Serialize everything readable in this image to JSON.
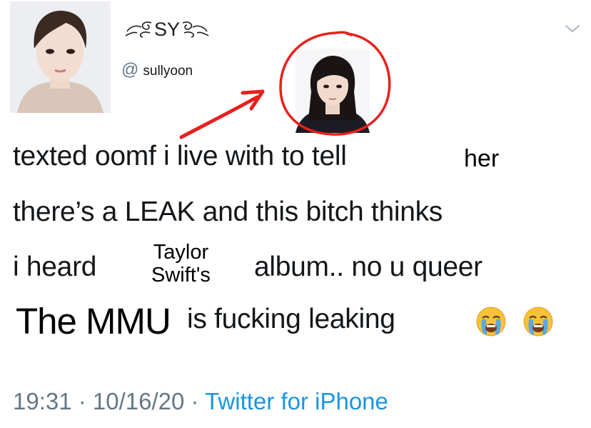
{
  "tweet": {
    "display_name": "⸙SY⸙",
    "display_name_text": "SY",
    "handle": "sullyoon",
    "handle_prefix": "@",
    "body": {
      "line_1": "texted oomf i live with to tell",
      "line_2": "there’s a LEAK and this bitch thinks",
      "line_3_before": "i heard",
      "line_3_after": "album.. no u queer",
      "line_4_after": "is fucking leaking"
    },
    "emojis": [
      "loudly-crying-face",
      "loudly-crying-face"
    ],
    "timestamp": "19:31 · 10/16/20 · ",
    "source": "Twitter for iPhone"
  },
  "overlays": {
    "her": "her",
    "taylor_line_1": "Taylor",
    "taylor_line_2": "Swift's",
    "mmu": "The MMU"
  },
  "colors": {
    "text": "#14171a",
    "meta_gray": "#657786",
    "link_blue": "#1b95e0",
    "annotation_red": "#e8201c"
  }
}
